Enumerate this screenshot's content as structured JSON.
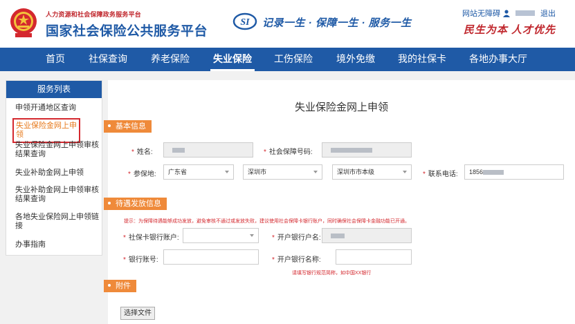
{
  "header": {
    "org_name": "人力资源和社会保障政务服务平台",
    "platform_name": "国家社会保险公共服务平台",
    "slogan": "记录一生 · 保障一生 · 服务一生",
    "accessibility_link": "网站无障碍",
    "logout_link": "退出",
    "motto": "民生为本 人才优先",
    "brand_color": "#1f5aa6",
    "accent_color": "#c0272d"
  },
  "nav": {
    "items": [
      "首页",
      "社保查询",
      "养老保险",
      "失业保险",
      "工伤保险",
      "境外免缴",
      "我的社保卡",
      "各地办事大厅"
    ],
    "active": "失业保险"
  },
  "sidebar": {
    "title": "服务列表",
    "items": [
      "申领开通地区查询",
      "失业保险金网上申领",
      "失业保险金网上申领审核结果查询",
      "失业补助金网上申领",
      "失业补助金网上申领审核结果查询",
      "各地失业保险网上申领链接",
      "办事指南"
    ],
    "active": "失业保险金网上申领"
  },
  "main": {
    "heading": "失业保险金网上申领",
    "sections": {
      "basic": "基本信息",
      "payment": "待遇发放信息",
      "attachment": "附件"
    },
    "basic": {
      "name_label": "姓名:",
      "ssn_label": "社会保障号码:",
      "insured_place_label": "参保地:",
      "province": "广东省",
      "city": "深圳市",
      "district": "深圳市市本级",
      "phone_label": "联系电话:",
      "phone_value": "1856"
    },
    "payment": {
      "notice": "提示：为保障待遇能够成功发放，避免审核不通过或发放失败，建议使用社会保障卡银行账户，同时确保社会保障卡金融功能已开通。",
      "bank_account_label": "社保卡银行账户:",
      "account_holder_label": "开户银行户名:",
      "bank_number_label": "银行账号:",
      "bank_name_label": "开户银行名称:",
      "bank_name_hint": "请填写银行规范简称，如中国XX银行"
    },
    "attachment": {
      "choose_file": "选择文件"
    }
  }
}
